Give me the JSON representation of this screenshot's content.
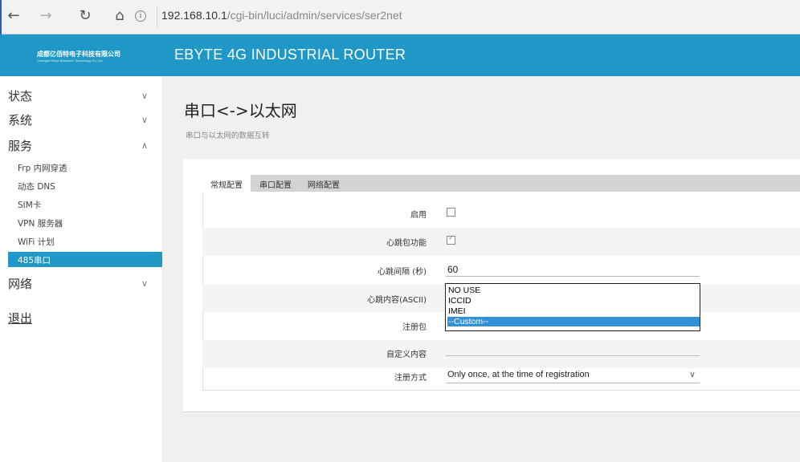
{
  "browser": {
    "back": "←",
    "forward": "→",
    "reload": "↻",
    "home": "⌂",
    "info": "i",
    "url_host": "192.168.10.1",
    "url_path": "/cgi-bin/luci/admin/services/ser2net"
  },
  "brand": {
    "logo_cn": "成都亿佰特电子科技有限公司",
    "logo_en": "Chengdu Ebyte Electronic Technology Co.,Ltd.",
    "title": "EBYTE 4G INDUSTRIAL ROUTER"
  },
  "sidebar": {
    "status": "状态",
    "system": "系统",
    "services": "服务",
    "network": "网络",
    "logout": "退出",
    "chev_down": "∨",
    "chev_up": "∧",
    "service_items": [
      "Frp 内网穿透",
      "动态 DNS",
      "SIM卡",
      "VPN 服务器",
      "WiFi 计划"
    ],
    "active_item": "485串口"
  },
  "page": {
    "title": "串口<->以太网",
    "subtitle": "串口与以太网的数据互转"
  },
  "tabs": [
    "常规配置",
    "串口配置",
    "网络配置"
  ],
  "form": {
    "enable_label": "启用",
    "heartbeat_label": "心跳包功能",
    "interval_label": "心跳间隔 (秒)",
    "interval_value": "60",
    "content_label": "心跳内容(ASCII)",
    "register_label": "注册包",
    "custom_label": "自定义内容",
    "register_mode_label": "注册方式",
    "register_mode_value": "Only once, at the time of registration",
    "select_chev": "∨",
    "enable_checked": false,
    "heartbeat_checked": true
  },
  "listbox": {
    "options": [
      "NO USE",
      "ICCID",
      "IMEI",
      "--Custom--"
    ],
    "selected": "--Custom--"
  },
  "colors": {
    "accent": "#1f97c7",
    "selection": "#3391d8"
  }
}
